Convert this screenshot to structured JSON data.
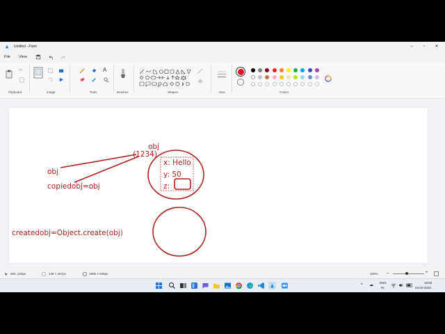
{
  "window": {
    "title": "Untitled - Paint"
  },
  "menu": {
    "file": "File",
    "view": "View"
  },
  "ribbon": {
    "groups": [
      "Clipboard",
      "Image",
      "Tools",
      "Brushes",
      "Shapes",
      "Size",
      "Colors"
    ]
  },
  "colors": {
    "primary": "#e81123",
    "secondary": "#ffffff",
    "palette_row1": [
      "#000000",
      "#7f7f7f",
      "#880015",
      "#ed1c24",
      "#ff7f27",
      "#fff200",
      "#22b14c",
      "#00a2e8",
      "#3f48cc",
      "#a349a4"
    ],
    "palette_row2": [
      "#ffffff",
      "#c3c3c3",
      "#b97a57",
      "#ffaec9",
      "#ffc90e",
      "#efe4b0",
      "#b5e61d",
      "#99d9ea",
      "#7092be",
      "#c8bfe7"
    ]
  },
  "canvas": {
    "ink_color": "#b01c1c",
    "obj_title": "obj",
    "address": "(1234)",
    "obj_label": "obj",
    "copied_label": "copiedobj=obj",
    "prop_x": "x: Hello",
    "prop_y": "y: 50",
    "prop_z": "z:",
    "created_label": "createdobj=Object.create(obj)"
  },
  "status": {
    "cursor": "650, 220px",
    "selection": "145 × 167px",
    "canvas_size": "1805 × 635px",
    "zoom": "100%"
  },
  "taskbar": {
    "lang_top": "ENG",
    "lang_bottom": "IN",
    "time": "19:50",
    "date": "03-03-2022"
  }
}
